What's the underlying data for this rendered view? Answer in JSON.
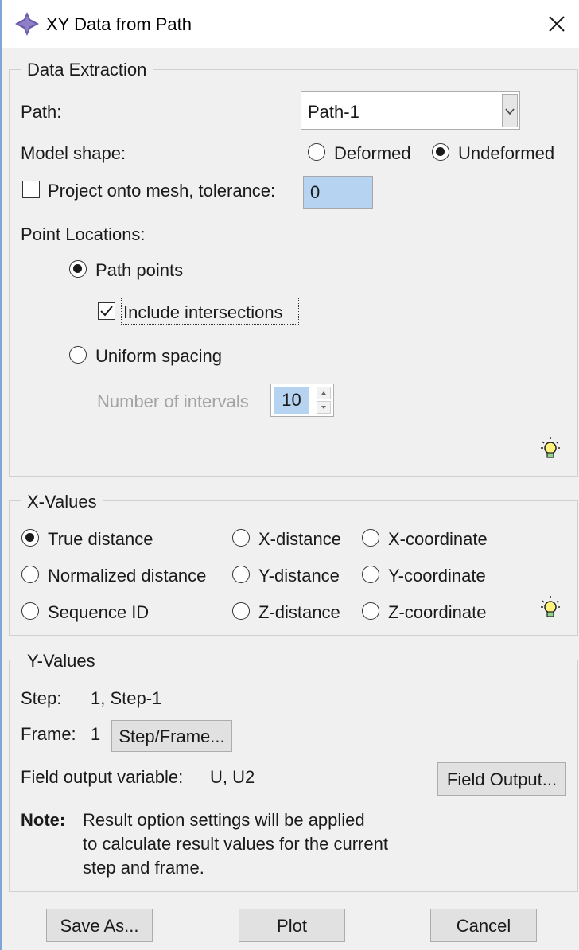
{
  "window": {
    "title": "XY Data from Path",
    "icons": {
      "app": "abaqus-cross-icon",
      "close": "close-icon"
    }
  },
  "data_extraction": {
    "legend": "Data Extraction",
    "path_label": "Path:",
    "path_value": "Path-1",
    "model_shape_label": "Model shape:",
    "shape_options": [
      {
        "label": "Deformed",
        "selected": false
      },
      {
        "label": "Undeformed",
        "selected": true
      }
    ],
    "project_label": "Project onto mesh, tolerance:",
    "project_checked": false,
    "tolerance_value": "0",
    "point_locations_label": "Point Locations:",
    "path_points_label": "Path points",
    "path_points_selected": true,
    "include_intersections_label": "Include intersections",
    "include_intersections_checked": true,
    "uniform_spacing_label": "Uniform spacing",
    "uniform_spacing_selected": false,
    "intervals_label": "Number of intervals",
    "intervals_value": "10",
    "hint_icon": "lightbulb-icon"
  },
  "x_values": {
    "legend": "X-Values",
    "options": [
      {
        "label": "True distance",
        "selected": true
      },
      {
        "label": "X-distance",
        "selected": false
      },
      {
        "label": "X-coordinate",
        "selected": false
      },
      {
        "label": "Normalized distance",
        "selected": false
      },
      {
        "label": "Y-distance",
        "selected": false
      },
      {
        "label": "Y-coordinate",
        "selected": false
      },
      {
        "label": "Sequence ID",
        "selected": false
      },
      {
        "label": "Z-distance",
        "selected": false
      },
      {
        "label": "Z-coordinate",
        "selected": false
      }
    ],
    "hint_icon": "lightbulb-icon"
  },
  "y_values": {
    "legend": "Y-Values",
    "step_label": "Step:",
    "step_value": "1, Step-1",
    "frame_label": "Frame:",
    "frame_value": "1",
    "step_frame_button": "Step/Frame...",
    "field_var_label": "Field output variable:",
    "field_var_value": "U, U2",
    "field_output_button": "Field Output...",
    "note_label": "Note:",
    "note_lines": [
      "Result option settings will be applied",
      "to calculate result values for the current",
      "step and frame."
    ]
  },
  "buttons": {
    "save_as": "Save As...",
    "plot": "Plot",
    "cancel": "Cancel"
  }
}
